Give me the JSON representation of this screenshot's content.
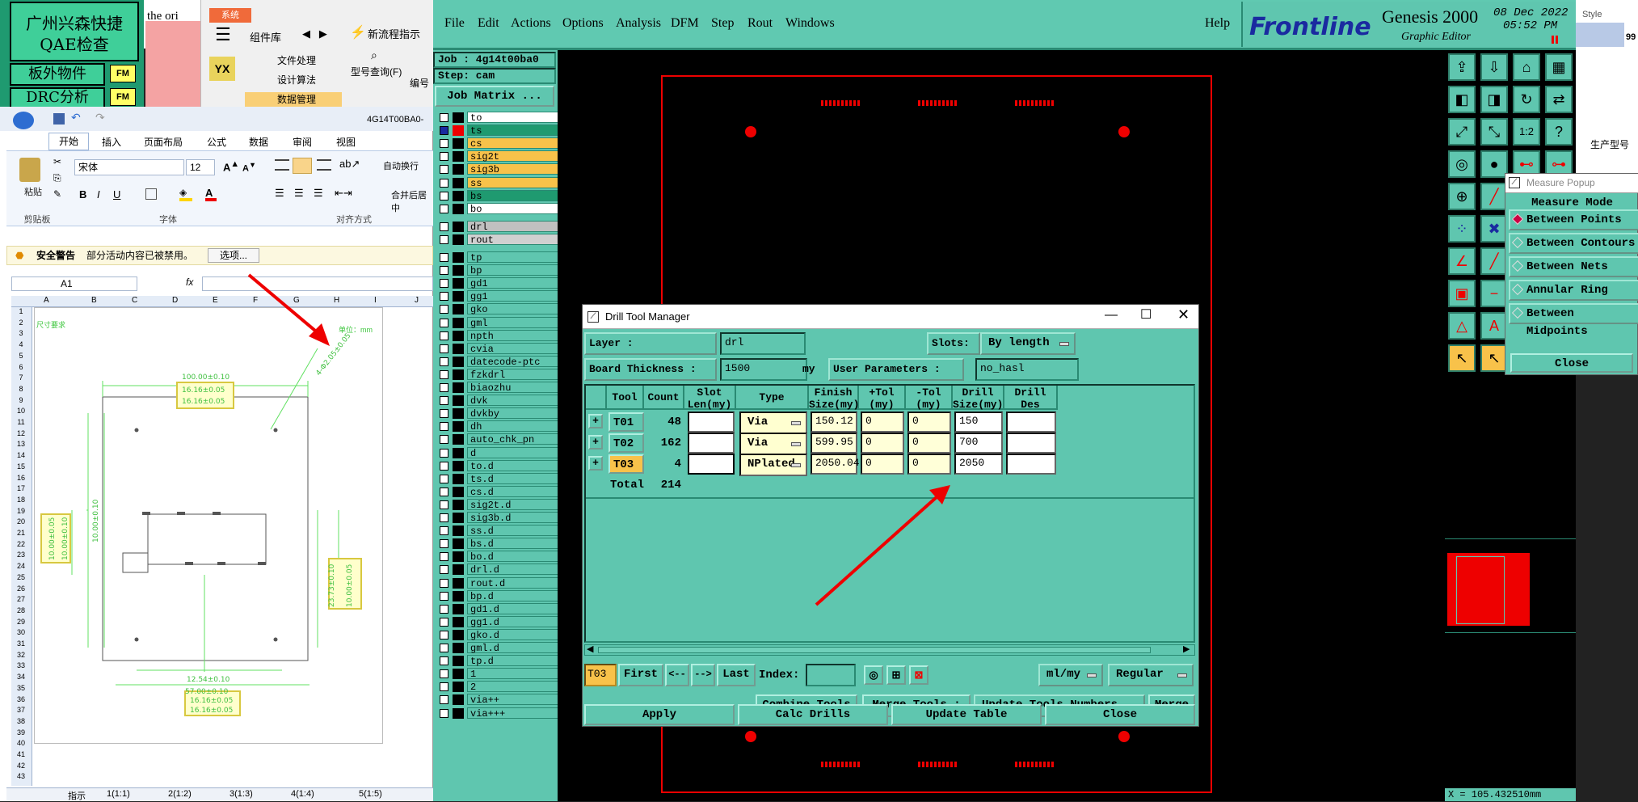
{
  "qae": {
    "title_line1": "广州兴森快捷",
    "title_line2": "QAE检查",
    "btn1": "板外物件",
    "btn2": "DRC分析",
    "fm": "FM",
    "peek_text": "the ori"
  },
  "top_mid": {
    "sys_tab": "系统",
    "lib": "组件库",
    "flow": "新流程指示",
    "items": [
      "文件处理",
      "设计算法",
      "数据管理"
    ],
    "model_query": "型号查询(F)",
    "edit": "编号"
  },
  "excel": {
    "window_title": "4G14T00BA0-",
    "tabs": [
      "开始",
      "插入",
      "页面布局",
      "公式",
      "数据",
      "审阅",
      "视图"
    ],
    "paste": "粘贴",
    "clipboard": "剪贴板",
    "font_group": "字体",
    "align_group": "对齐方式",
    "font_name": "宋体",
    "font_size": "12",
    "wrap": "自动换行",
    "merge": "合并后居中",
    "security_title": "安全警告",
    "security_msg": "部分活动内容已被禁用。",
    "options_btn": "选项...",
    "cell_ref": "A1",
    "fx": "fx",
    "cols": [
      "A",
      "B",
      "C",
      "D",
      "E",
      "F",
      "G",
      "H",
      "I",
      "J"
    ],
    "rows": [
      "1",
      "2",
      "3",
      "4",
      "5",
      "6",
      "7",
      "8",
      "9",
      "10",
      "11",
      "12",
      "13",
      "14",
      "15",
      "16",
      "17",
      "18",
      "19",
      "20",
      "21",
      "22",
      "23",
      "24",
      "25",
      "26",
      "27",
      "28",
      "29",
      "30",
      "31",
      "32",
      "33",
      "34",
      "35",
      "36",
      "37",
      "38",
      "39",
      "40",
      "41",
      "42",
      "43"
    ],
    "drawing_header_left": "尺寸要求",
    "drawing_header_right": "单位：mm",
    "dims": {
      "d1": "100.00±0.10",
      "d2": "16.16±0.05",
      "d3": "16.16±0.05",
      "d4": "4-Φ2.05±0.05",
      "d5": "10.00±0.05",
      "d6": "10.00±0.10",
      "d7": "10.00±0.10",
      "d8": "23.73±0.10",
      "d9": "10.00±0.05",
      "d10": "12.54±0.10",
      "d11": "57.00±0.10",
      "d12": "16.16±0.05",
      "d13": "16.16±0.05"
    },
    "sheet_tabs": [
      "指示",
      "1(1:1)",
      "2(1:2)",
      "3(1:3)",
      "4(1:4)",
      "5(1:5)"
    ]
  },
  "genesis": {
    "menus": [
      "File",
      "Edit",
      "Actions",
      "Options",
      "Analysis",
      "DFM",
      "Step",
      "Rout",
      "Windows"
    ],
    "help": "Help",
    "brand": "Frontline",
    "product": "Genesis 2000",
    "subtitle": "Graphic Editor",
    "date": "08 Dec 2022",
    "time": "05:52 PM",
    "style": "Style",
    "job": "Job : 4g14t00ba0",
    "step": "Step: cam",
    "job_matrix": "Job Matrix ...",
    "layers": [
      "to",
      "ts",
      "cs",
      "sig2t",
      "sig3b",
      "ss",
      "bs",
      "bo",
      "drl",
      "rout",
      "tp",
      "bp",
      "gd1",
      "gg1",
      "gko",
      "gml",
      "npth",
      "cvia",
      "datecode-ptc",
      "fzkdrl",
      "biaozhu",
      "dvk",
      "dvkby",
      "dh",
      "auto_chk_pn",
      "d",
      "to.d",
      "ts.d",
      "cs.d",
      "sig2t.d",
      "sig3b.d",
      "ss.d",
      "bs.d",
      "bo.d",
      "drl.d",
      "rout.d",
      "bp.d",
      "gd1.d",
      "gg1.d",
      "gko.d",
      "gml.d",
      "tp.d",
      "1",
      "2",
      "via++",
      "via+++"
    ],
    "coord": "X = 105.432510mm",
    "far_right": "生产型号",
    "far_num": "99"
  },
  "dialog": {
    "title": "Drill Tool Manager",
    "layer_label": "Layer        :",
    "layer_value": "drl",
    "slots_label": "Slots:",
    "slots_value": "By length",
    "thickness_label": "Board Thickness :",
    "thickness_value": "1500",
    "thickness_unit": "my",
    "user_params_label": "User Parameters :",
    "user_params_value": "no_hasl",
    "headers": [
      {
        "l1": "",
        "l2": ""
      },
      {
        "l1": "Tool",
        "l2": ""
      },
      {
        "l1": "Count",
        "l2": ""
      },
      {
        "l1": "Slot",
        "l2": "Len(my)"
      },
      {
        "l1": "Type",
        "l2": ""
      },
      {
        "l1": "Finish",
        "l2": "Size(my)"
      },
      {
        "l1": "+Tol",
        "l2": "(my)"
      },
      {
        "l1": "-Tol",
        "l2": "(my)"
      },
      {
        "l1": "Drill",
        "l2": "Size(my)"
      },
      {
        "l1": "Drill",
        "l2": "Des"
      }
    ],
    "rows": [
      {
        "tool": "T01",
        "count": "48",
        "slot": "",
        "type": "Via",
        "finish": "150.12",
        "ptol": "0",
        "ntol": "0",
        "drill": "150",
        "des": ""
      },
      {
        "tool": "T02",
        "count": "162",
        "slot": "",
        "type": "Via",
        "finish": "599.95",
        "ptol": "0",
        "ntol": "0",
        "drill": "700",
        "des": ""
      },
      {
        "tool": "T03",
        "count": "4",
        "slot": "",
        "type": "NPlated",
        "finish": "2050.04",
        "ptol": "0",
        "ntol": "0",
        "drill": "2050",
        "des": ""
      }
    ],
    "total_label": "Total",
    "total_count": "214",
    "current_tool": "T03",
    "first": "First",
    "prev": "<--",
    "next": "-->",
    "last": "Last",
    "index_label": "Index:",
    "index_value": "",
    "units": "ml/my",
    "mode": "Regular",
    "combine": "Combine Tools",
    "merge_label": "Merge Tools :",
    "update_numbers": "Update Tools Numbers",
    "merge_btn": "Merge",
    "apply": "Apply",
    "calc": "Calc Drills",
    "update_table": "Update Table",
    "close": "Close"
  },
  "measure": {
    "title": "Measure Popup",
    "mode": "Measure Mode",
    "options": [
      "Between Points",
      "Between Contours",
      "Between Nets",
      "Annular Ring",
      "Between Midpoints"
    ],
    "selected": 0,
    "close": "Close"
  },
  "colors": {
    "genesis_bg": "#5fc6af",
    "highlight": "#f8c24a",
    "red": "#e00000"
  }
}
